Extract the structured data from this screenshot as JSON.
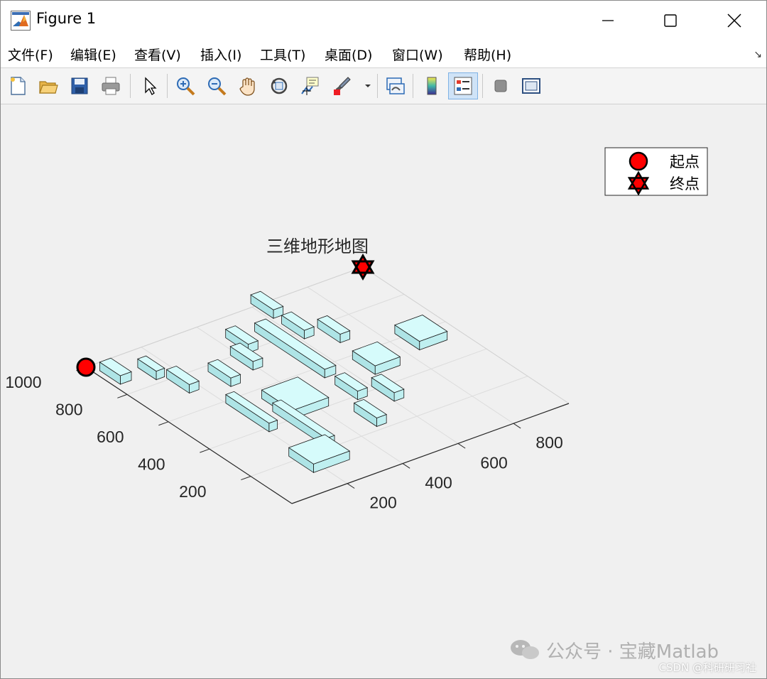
{
  "window": {
    "title": "Figure 1",
    "controls": [
      "minimize-icon",
      "maximize-icon",
      "close-icon"
    ]
  },
  "menubar": {
    "items": [
      "文件(F)",
      "编辑(E)",
      "查看(V)",
      "插入(I)",
      "工具(T)",
      "桌面(D)",
      "窗口(W)",
      "帮助(H)"
    ]
  },
  "toolbar": {
    "icons": [
      "new-figure-icon",
      "open-file-icon",
      "save-icon",
      "print-icon",
      "select-arrow-icon",
      "zoom-in-icon",
      "zoom-out-icon",
      "pan-hand-icon",
      "rotate-3d-icon",
      "data-cursor-icon",
      "brush-icon",
      "brush-dropdown-icon",
      "link-plot-icon",
      "colorbar-icon",
      "legend-icon",
      "hide-plot-tools-icon",
      "show-plot-tools-icon"
    ],
    "active": "legend-icon"
  },
  "chart_data": {
    "type": "3d-terrain",
    "title": "三维地形地图",
    "xlim": [
      0,
      1000
    ],
    "ylim": [
      0,
      1000
    ],
    "xticks": [
      200,
      400,
      600,
      800
    ],
    "yticks": [
      200,
      400,
      600,
      800,
      1000
    ],
    "grid": true,
    "legend": {
      "placement": "top-right",
      "entries": [
        {
          "label": "起点",
          "marker": "circle",
          "color": "#ff0000"
        },
        {
          "label": "终点",
          "marker": "hexagram",
          "color": "#ff0000"
        }
      ]
    },
    "start": {
      "x": 0,
      "y": 1000
    },
    "end": {
      "x": 1000,
      "y": 1000
    },
    "obstacles": [
      {
        "x": 20,
        "y": 860,
        "w": 40,
        "d": 100
      },
      {
        "x": 120,
        "y": 820,
        "w": 30,
        "d": 90
      },
      {
        "x": 150,
        "y": 700,
        "w": 35,
        "d": 110
      },
      {
        "x": 270,
        "y": 660,
        "w": 35,
        "d": 110
      },
      {
        "x": 280,
        "y": 210,
        "w": 30,
        "d": 260
      },
      {
        "x": 200,
        "y": 380,
        "w": 30,
        "d": 210
      },
      {
        "x": 160,
        "y": 110,
        "w": 130,
        "d": 120
      },
      {
        "x": 300,
        "y": 400,
        "w": 130,
        "d": 150
      },
      {
        "x": 380,
        "y": 700,
        "w": 35,
        "d": 110
      },
      {
        "x": 430,
        "y": 790,
        "w": 35,
        "d": 110
      },
      {
        "x": 520,
        "y": 540,
        "w": 40,
        "d": 340
      },
      {
        "x": 610,
        "y": 910,
        "w": 35,
        "d": 110
      },
      {
        "x": 610,
        "y": 760,
        "w": 35,
        "d": 110
      },
      {
        "x": 520,
        "y": 380,
        "w": 35,
        "d": 110
      },
      {
        "x": 470,
        "y": 220,
        "w": 35,
        "d": 110
      },
      {
        "x": 600,
        "y": 310,
        "w": 35,
        "d": 110
      },
      {
        "x": 650,
        "y": 470,
        "w": 90,
        "d": 110
      },
      {
        "x": 680,
        "y": 680,
        "w": 35,
        "d": 110
      },
      {
        "x": 840,
        "y": 510,
        "w": 100,
        "d": 120
      }
    ]
  },
  "watermark": {
    "text": "公众号 · 宝藏Matlab",
    "csdn": "CSDN @科研研习社"
  }
}
